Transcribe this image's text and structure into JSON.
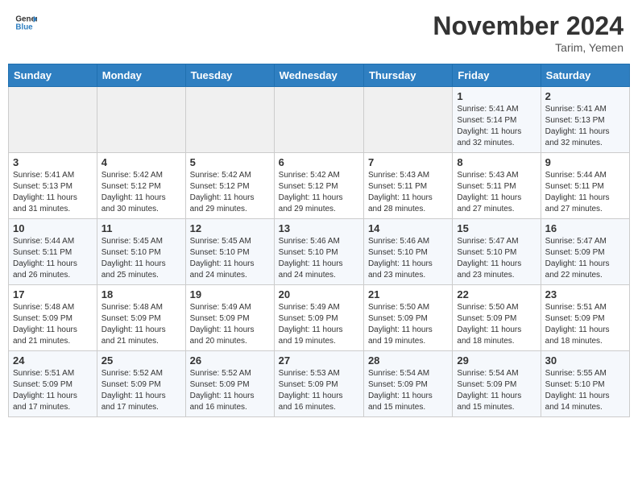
{
  "header": {
    "logo_line1": "General",
    "logo_line2": "Blue",
    "month_title": "November 2024",
    "location": "Tarim, Yemen"
  },
  "days_of_week": [
    "Sunday",
    "Monday",
    "Tuesday",
    "Wednesday",
    "Thursday",
    "Friday",
    "Saturday"
  ],
  "weeks": [
    [
      {
        "day": "",
        "info": ""
      },
      {
        "day": "",
        "info": ""
      },
      {
        "day": "",
        "info": ""
      },
      {
        "day": "",
        "info": ""
      },
      {
        "day": "",
        "info": ""
      },
      {
        "day": "1",
        "info": "Sunrise: 5:41 AM\nSunset: 5:14 PM\nDaylight: 11 hours\nand 32 minutes."
      },
      {
        "day": "2",
        "info": "Sunrise: 5:41 AM\nSunset: 5:13 PM\nDaylight: 11 hours\nand 32 minutes."
      }
    ],
    [
      {
        "day": "3",
        "info": "Sunrise: 5:41 AM\nSunset: 5:13 PM\nDaylight: 11 hours\nand 31 minutes."
      },
      {
        "day": "4",
        "info": "Sunrise: 5:42 AM\nSunset: 5:12 PM\nDaylight: 11 hours\nand 30 minutes."
      },
      {
        "day": "5",
        "info": "Sunrise: 5:42 AM\nSunset: 5:12 PM\nDaylight: 11 hours\nand 29 minutes."
      },
      {
        "day": "6",
        "info": "Sunrise: 5:42 AM\nSunset: 5:12 PM\nDaylight: 11 hours\nand 29 minutes."
      },
      {
        "day": "7",
        "info": "Sunrise: 5:43 AM\nSunset: 5:11 PM\nDaylight: 11 hours\nand 28 minutes."
      },
      {
        "day": "8",
        "info": "Sunrise: 5:43 AM\nSunset: 5:11 PM\nDaylight: 11 hours\nand 27 minutes."
      },
      {
        "day": "9",
        "info": "Sunrise: 5:44 AM\nSunset: 5:11 PM\nDaylight: 11 hours\nand 27 minutes."
      }
    ],
    [
      {
        "day": "10",
        "info": "Sunrise: 5:44 AM\nSunset: 5:11 PM\nDaylight: 11 hours\nand 26 minutes."
      },
      {
        "day": "11",
        "info": "Sunrise: 5:45 AM\nSunset: 5:10 PM\nDaylight: 11 hours\nand 25 minutes."
      },
      {
        "day": "12",
        "info": "Sunrise: 5:45 AM\nSunset: 5:10 PM\nDaylight: 11 hours\nand 24 minutes."
      },
      {
        "day": "13",
        "info": "Sunrise: 5:46 AM\nSunset: 5:10 PM\nDaylight: 11 hours\nand 24 minutes."
      },
      {
        "day": "14",
        "info": "Sunrise: 5:46 AM\nSunset: 5:10 PM\nDaylight: 11 hours\nand 23 minutes."
      },
      {
        "day": "15",
        "info": "Sunrise: 5:47 AM\nSunset: 5:10 PM\nDaylight: 11 hours\nand 23 minutes."
      },
      {
        "day": "16",
        "info": "Sunrise: 5:47 AM\nSunset: 5:09 PM\nDaylight: 11 hours\nand 22 minutes."
      }
    ],
    [
      {
        "day": "17",
        "info": "Sunrise: 5:48 AM\nSunset: 5:09 PM\nDaylight: 11 hours\nand 21 minutes."
      },
      {
        "day": "18",
        "info": "Sunrise: 5:48 AM\nSunset: 5:09 PM\nDaylight: 11 hours\nand 21 minutes."
      },
      {
        "day": "19",
        "info": "Sunrise: 5:49 AM\nSunset: 5:09 PM\nDaylight: 11 hours\nand 20 minutes."
      },
      {
        "day": "20",
        "info": "Sunrise: 5:49 AM\nSunset: 5:09 PM\nDaylight: 11 hours\nand 19 minutes."
      },
      {
        "day": "21",
        "info": "Sunrise: 5:50 AM\nSunset: 5:09 PM\nDaylight: 11 hours\nand 19 minutes."
      },
      {
        "day": "22",
        "info": "Sunrise: 5:50 AM\nSunset: 5:09 PM\nDaylight: 11 hours\nand 18 minutes."
      },
      {
        "day": "23",
        "info": "Sunrise: 5:51 AM\nSunset: 5:09 PM\nDaylight: 11 hours\nand 18 minutes."
      }
    ],
    [
      {
        "day": "24",
        "info": "Sunrise: 5:51 AM\nSunset: 5:09 PM\nDaylight: 11 hours\nand 17 minutes."
      },
      {
        "day": "25",
        "info": "Sunrise: 5:52 AM\nSunset: 5:09 PM\nDaylight: 11 hours\nand 17 minutes."
      },
      {
        "day": "26",
        "info": "Sunrise: 5:52 AM\nSunset: 5:09 PM\nDaylight: 11 hours\nand 16 minutes."
      },
      {
        "day": "27",
        "info": "Sunrise: 5:53 AM\nSunset: 5:09 PM\nDaylight: 11 hours\nand 16 minutes."
      },
      {
        "day": "28",
        "info": "Sunrise: 5:54 AM\nSunset: 5:09 PM\nDaylight: 11 hours\nand 15 minutes."
      },
      {
        "day": "29",
        "info": "Sunrise: 5:54 AM\nSunset: 5:09 PM\nDaylight: 11 hours\nand 15 minutes."
      },
      {
        "day": "30",
        "info": "Sunrise: 5:55 AM\nSunset: 5:10 PM\nDaylight: 11 hours\nand 14 minutes."
      }
    ]
  ]
}
